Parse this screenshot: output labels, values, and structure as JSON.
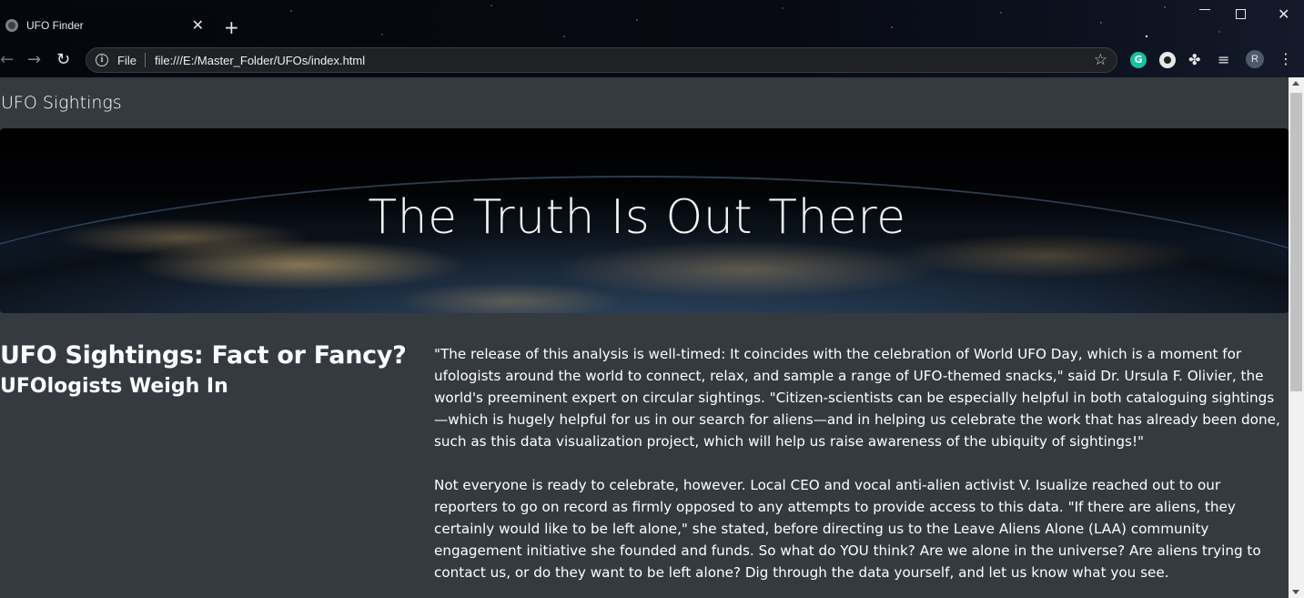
{
  "browser": {
    "tab_title": "UFO Finder",
    "tab_close": "✕",
    "new_tab": "+",
    "win_close": "✕",
    "file_chip": "File",
    "url": "file:///E:/Master_Folder/UFOs/index.html",
    "back": "←",
    "forward": "→",
    "reload": "↻",
    "star": "☆",
    "grammarly": "G",
    "puzzle": "✤",
    "media": "≡",
    "avatar_initial": "R",
    "menu": "⋮",
    "icons": [
      "globe-icon",
      "close-icon",
      "plus-icon",
      "back-arrow-icon",
      "forward-arrow-icon",
      "reload-icon",
      "info-icon",
      "star-icon",
      "grammarly-icon",
      "extension-icon",
      "puzzle-icon",
      "media-control-icon",
      "profile-avatar",
      "more-menu-icon"
    ]
  },
  "page": {
    "brand": "UFO Sightings",
    "hero_title": "The Truth Is Out There",
    "headline": "UFO Sightings: Fact or Fancy?",
    "subhead": "UFOlogists Weigh In",
    "paragraphs": [
      "\"The release of this analysis is well-timed: It coincides with the celebration of World UFO Day, which is a moment for ufologists around the world to connect, relax, and sample a range of UFO-themed snacks,\" said Dr. Ursula F. Olivier, the world's preeminent expert on circular sightings. \"Citizen-scientists can be especially helpful in both cataloguing sightings—which is hugely helpful for us in our search for aliens—and in helping us celebrate the work that has already been done, such as this data visualization project, which will help us raise awareness of the ubiquity of sightings!\"",
      "Not everyone is ready to celebrate, however. Local CEO and vocal anti-alien activist V. Isualize reached out to our reporters to go on record as firmly opposed to any attempts to provide access to this data. \"If there are aliens, they certainly would like to be left alone,\" she stated, before directing us to the Leave Aliens Alone (LAA) community engagement initiative she founded and funds. So what do YOU think? Are we alone in the universe? Are aliens trying to contact us, or do they want to be left alone? Dig through the data yourself, and let us know what you see."
    ]
  },
  "colors": {
    "page_bg": "#343a40",
    "text": "#ffffff",
    "scrollbar_track": "#f1f1f1",
    "scrollbar_thumb": "#c1c1c1"
  }
}
